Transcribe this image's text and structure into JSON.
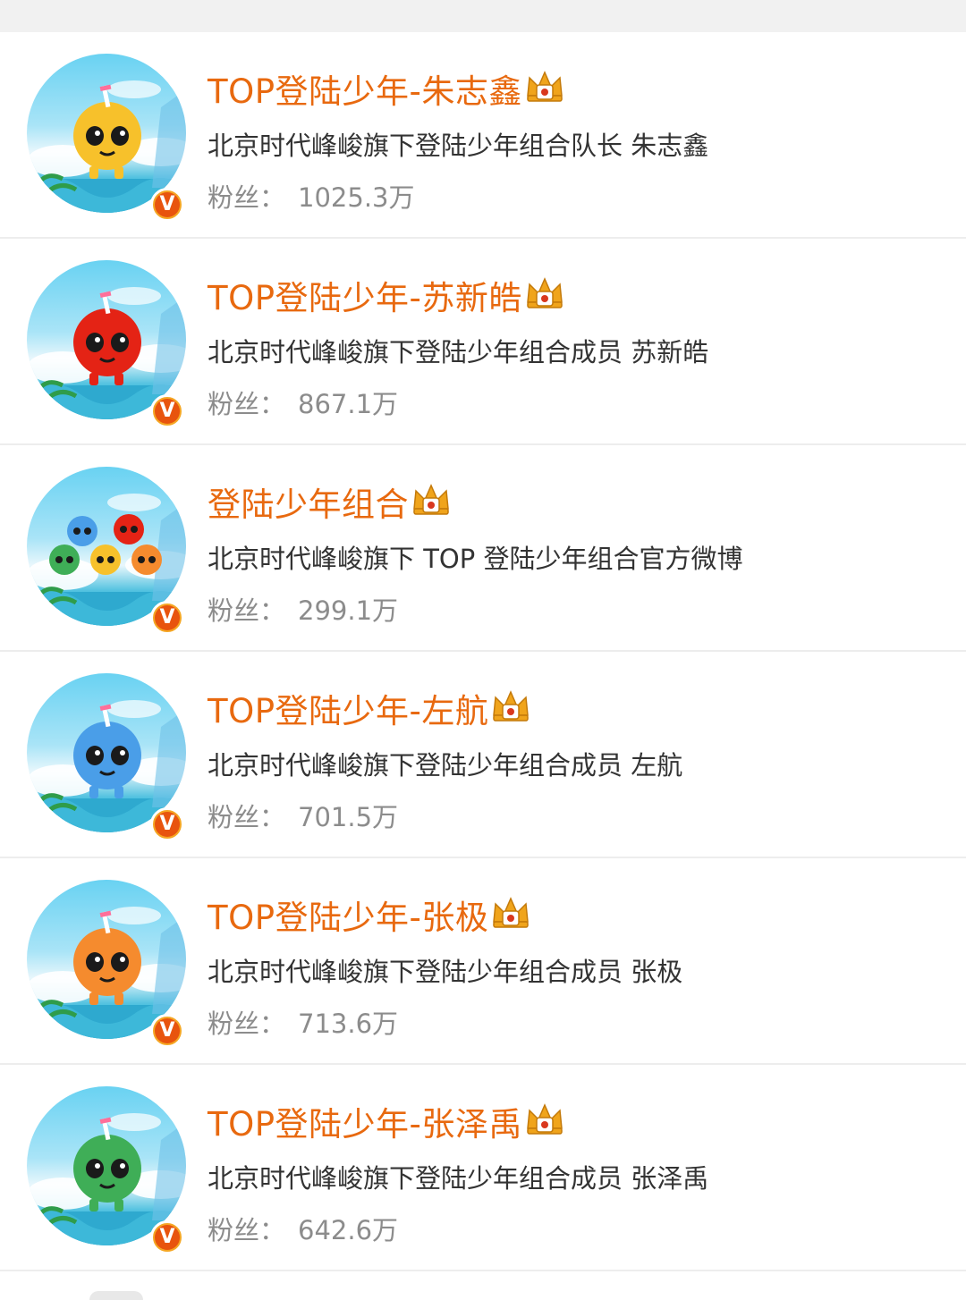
{
  "accounts": [
    {
      "name": "TOP登陆少年-朱志鑫",
      "description": "北京时代峰峻旗下登陆少年组合队长 朱志鑫",
      "fans_label": "粉丝：",
      "fans_value": "1025.3万",
      "mascot_color": "#f7c12b",
      "avatar_icon": "yellow-coconut-mascot-icon"
    },
    {
      "name": "TOP登陆少年-苏新皓",
      "description": "北京时代峰峻旗下登陆少年组合成员 苏新皓",
      "fans_label": "粉丝：",
      "fans_value": "867.1万",
      "mascot_color": "#e42315",
      "avatar_icon": "red-coconut-mascot-icon"
    },
    {
      "name": "登陆少年组合",
      "description": "北京时代峰峻旗下 TOP 登陆少年组合官方微博",
      "fans_label": "粉丝：",
      "fans_value": "299.1万",
      "mascot_color": "#f7c12b",
      "avatar_icon": "group-coconut-mascots-icon"
    },
    {
      "name": "TOP登陆少年-左航",
      "description": "北京时代峰峻旗下登陆少年组合成员 左航",
      "fans_label": "粉丝：",
      "fans_value": "701.5万",
      "mascot_color": "#4a9ee8",
      "avatar_icon": "blue-coconut-mascot-icon"
    },
    {
      "name": "TOP登陆少年-张极",
      "description": "北京时代峰峻旗下登陆少年组合成员 张极",
      "fans_label": "粉丝：",
      "fans_value": "713.6万",
      "mascot_color": "#f58b2e",
      "avatar_icon": "orange-coconut-mascot-icon"
    },
    {
      "name": "TOP登陆少年-张泽禹",
      "description": "北京时代峰峻旗下登陆少年组合成员 张泽禹",
      "fans_label": "粉丝：",
      "fans_value": "642.6万",
      "mascot_color": "#3fae57",
      "avatar_icon": "green-coconut-mascot-icon"
    }
  ],
  "colors": {
    "name": "#e8690f",
    "description": "#333333",
    "fans": "#8c8c8c",
    "verified_badge": "#e8540e",
    "crown": "#f0a41b"
  },
  "icons": {
    "verified": "verified-v-icon",
    "member_crown": "crown-icon"
  },
  "badge_text": "V"
}
